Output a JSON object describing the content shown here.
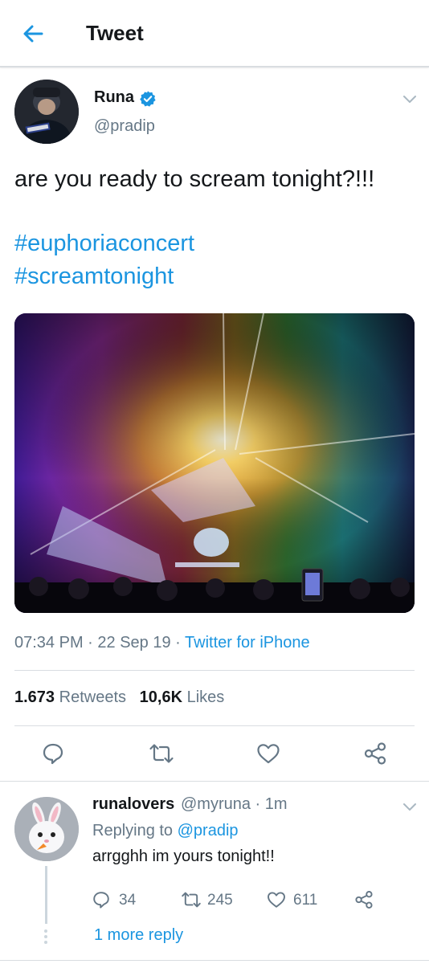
{
  "header": {
    "title": "Tweet",
    "back_icon": "arrow-left-icon"
  },
  "tweet": {
    "author_name": "Runa",
    "author_handle": "@pradip",
    "verified": true,
    "text": "are you ready to scream tonight?!!!",
    "hashtags": [
      "#euphoriaconcert",
      "#screamtonight"
    ],
    "time": "07:34 PM",
    "date": "22 Sep 19",
    "source": "Twitter for iPhone",
    "retweets_count": "1.673",
    "retweets_label": "Retweets",
    "likes_count": "10,6K",
    "likes_label": "Likes"
  },
  "reply": {
    "author_name": "runalovers",
    "author_handle": "@myruna",
    "time_ago": "1m",
    "replying_to_label": "Replying to",
    "replying_to": "@pradip",
    "text": "arrgghh im yours tonight!!",
    "reply_count": "34",
    "retweet_count": "245",
    "like_count": "611",
    "more_replies": "1 more reply"
  },
  "colors": {
    "accent": "#1b95e0",
    "secondary_text": "#657786",
    "primary_text": "#14171a",
    "divider": "#d9dde1"
  }
}
